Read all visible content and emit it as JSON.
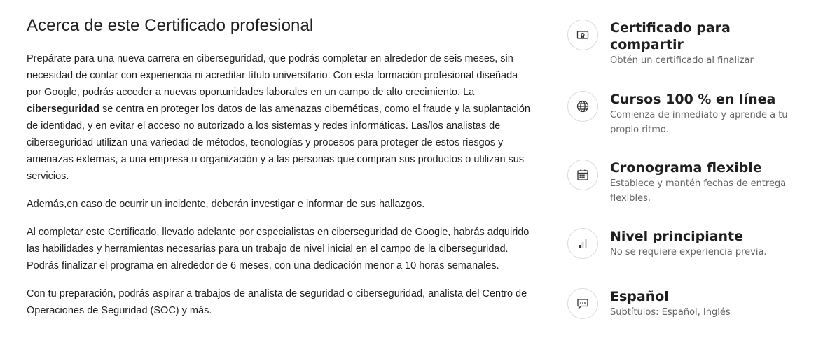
{
  "about": {
    "title": "Acerca de este Certificado profesional",
    "p1_before": "Prepárate para una nueva carrera en ciberseguridad, que podrás completar en alrededor de seis meses, sin necesidad de contar con experiencia ni acreditar título universitario. Con esta formación profesional diseñada por Google, podrás acceder a nuevas oportunidades laborales en un campo de alto crecimiento. La ",
    "p1_bold": "ciberseguridad",
    "p1_after": " se centra en proteger los datos de las amenazas cibernéticas, como el fraude y la suplantación de identidad, y en evitar el acceso no autorizado a los sistemas y redes informáticas. Las/los analistas de ciberseguridad utilizan una variedad de métodos, tecnologías y procesos para proteger de estos riesgos y amenazas externas, a una empresa u organización y a las personas que compran sus productos o utilizan sus servicios.",
    "p2": "Además,en caso de ocurrir un incidente, deberán investigar e informar de sus hallazgos.",
    "p3": "Al completar este Certificado, llevado adelante por especialistas en ciberseguridad de Google, habrás adquirido las habilidades y herramientas necesarias para un trabajo de nivel inicial en el campo de la ciberseguridad.  Podrás finalizar el programa en alrededor de 6 meses, con una dedicación menor a 10 horas semanales.",
    "p4": "Con tu preparación, podrás aspirar a trabajos de analista de seguridad o ciberseguridad, analista del Centro de Operaciones de Seguridad (SOC) y más."
  },
  "features": [
    {
      "icon": "certificate-icon",
      "title": "Certificado para compartir",
      "subtitle": "Obtén un certificado al finalizar"
    },
    {
      "icon": "globe-icon",
      "title": "Cursos 100 % en línea",
      "subtitle": "Comienza de inmediato y aprende a tu propio ritmo."
    },
    {
      "icon": "calendar-icon",
      "title": "Cronograma flexible",
      "subtitle": "Establece y mantén fechas de entrega flexibles."
    },
    {
      "icon": "level-bars-icon",
      "title": "Nivel principiante",
      "subtitle": "No se requiere experiencia previa."
    },
    {
      "icon": "chat-bubble-icon",
      "title": "Español",
      "subtitle": "Subtítulos: Español, Inglés"
    }
  ],
  "colors": {
    "text": "#1f1f1f",
    "muted": "#636363",
    "icon": "#333333",
    "circle_border": "#dadada"
  }
}
